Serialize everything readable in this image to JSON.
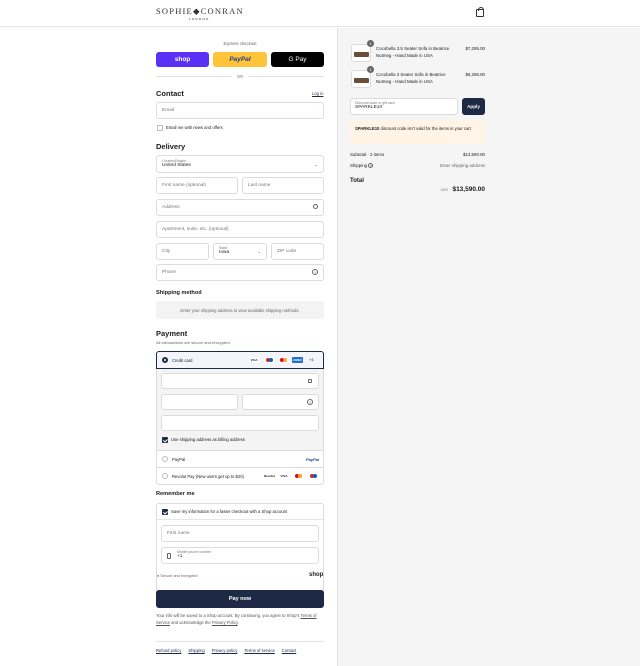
{
  "brand": {
    "name": "SOPHIE◆CONRAN",
    "sub": "LONDON"
  },
  "express": {
    "label": "Express checkout",
    "shop": "shop",
    "paypal": "PayPal",
    "gpay": "G Pay",
    "or": "OR"
  },
  "contact": {
    "title": "Contact",
    "login": "Log in",
    "email_placeholder": "Email",
    "news_label": "Email me with news and offers"
  },
  "delivery": {
    "title": "Delivery",
    "country_label": "Country/Region",
    "country": "United States",
    "first": "First name (optional)",
    "last": "Last name",
    "address": "Address",
    "apt": "Apartment, suite, etc. (optional)",
    "city": "City",
    "state_label": "State",
    "state": "Iowa",
    "zip": "ZIP code",
    "phone": "Phone"
  },
  "shipping_method": {
    "title": "Shipping method",
    "note": "Enter your shipping address to view available shipping methods."
  },
  "payment": {
    "title": "Payment",
    "secure": "All transactions are secure and encrypted.",
    "credit_card": "Credit card",
    "more_cards": "+4",
    "billing_label": "Use shipping address as billing address",
    "paypal": "PayPal",
    "paypal_logo": "PayPal",
    "revolut": "Revolut Pay (New users get up to $20)",
    "revolut_logo": "Revolut"
  },
  "remember": {
    "title": "Remember me",
    "save_label": "Save my information for a faster checkout with a Shop account",
    "first": "First name",
    "mobile_label": "Mobile phone number",
    "mobile_prefix": "+1",
    "secure": "Secure and encrypted",
    "shop": "shop"
  },
  "pay": {
    "label": "Pay now",
    "legal_1": "Your info will be saved to a Shop account. By continuing, you agree to Shop’s",
    "tos": "Terms of Service",
    "legal_2": " and acknowledge the ",
    "privacy": "Privacy Policy",
    "legal_3": "."
  },
  "footer": [
    "Refund policy",
    "Shipping",
    "Privacy policy",
    "Terms of service",
    "Contact"
  ],
  "cart": {
    "items": [
      {
        "qty": "1",
        "name": "Cocobella 3.5 Seater Sofa in Beatrice Nutmeg - Hand Made in USA",
        "price": "$7,295.00"
      },
      {
        "qty": "1",
        "name": "Cocobella 3 Seater Sofa in Beatrice Nutmeg - Hand Made in USA",
        "price": "$6,295.00"
      }
    ],
    "discount_label": "Discount code or gift card",
    "discount_value": "SPARKLE10",
    "apply": "Apply",
    "alert_code": "SPARKLE10",
    "alert_text": " discount code isn’t valid for the items in your cart",
    "subtotal_label": "Subtotal · 2 items",
    "subtotal": "$13,590.00",
    "shipping_label": "Shipping",
    "shipping_value": "Enter shipping address",
    "total_label": "Total",
    "currency": "USD",
    "total": "$13,590.00"
  },
  "colors": {
    "navy": "#1e2a45",
    "shop": "#5a31f4",
    "paypal": "#ffc439",
    "alert_bg": "#fff4e5"
  }
}
